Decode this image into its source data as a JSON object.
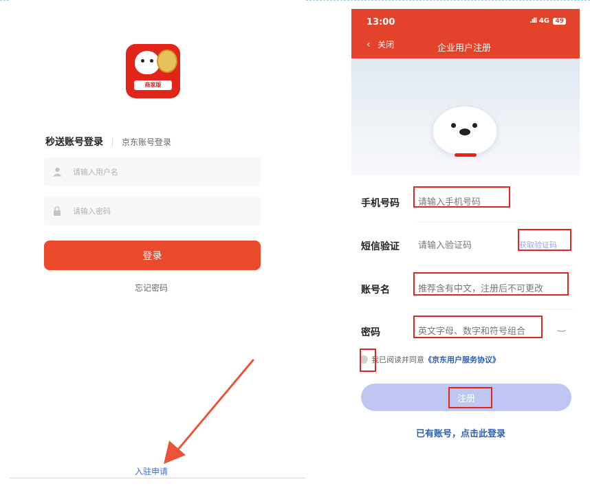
{
  "left": {
    "logo_badge": "商家版",
    "tab_active": "秒送账号登录",
    "tab_inactive": "京东账号登录",
    "username_placeholder": "请输入用户名",
    "password_placeholder": "请输入密码",
    "login_button": "登录",
    "forgot_password": "忘记密码",
    "apply_link": "入驻申请"
  },
  "right": {
    "status_time": "13:00",
    "status_signal": "4G",
    "status_battery": "49",
    "back_label": "关闭",
    "page_title": "企业用户注册",
    "phone": {
      "label": "手机号码",
      "placeholder": "请输入手机号码"
    },
    "sms": {
      "label": "短信验证",
      "placeholder": "请输入验证码",
      "get_code": "获取验证码"
    },
    "account": {
      "label": "账号名",
      "placeholder": "推荐含有中文，注册后不可更改"
    },
    "password": {
      "label": "密码",
      "placeholder": "英文字母、数字和符号组合"
    },
    "agree_text": "我已阅读并同意",
    "agreement_link": "《京东用户服务协议》",
    "register_button": "注册",
    "login_link": "已有账号，点击此登录"
  },
  "colors": {
    "brand_red": "#e1251b",
    "login_button": "#ec4a2c",
    "register_button": "#bdc7f2",
    "link_blue": "#2a5fb8",
    "highlight_box": "#e1251b",
    "arrow": "#e8553a"
  },
  "icons": [
    "user-icon",
    "lock-icon",
    "back-chevron-icon",
    "signal-icon",
    "battery-icon",
    "eye-toggle-icon",
    "check-circle-icon",
    "pointer-arrow-icon"
  ]
}
